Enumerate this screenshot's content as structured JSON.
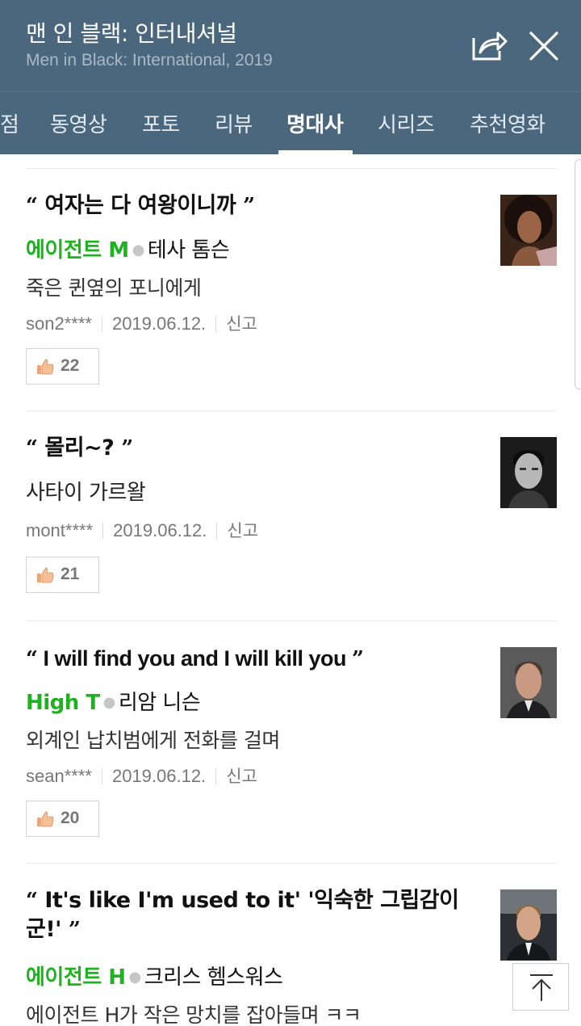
{
  "header": {
    "title": "맨 인 블랙: 인터내셔널",
    "subtitle": "Men in Black: International, 2019"
  },
  "tabs": [
    {
      "label": "점"
    },
    {
      "label": "동영상"
    },
    {
      "label": "포토"
    },
    {
      "label": "리뷰"
    },
    {
      "label": "명대사",
      "active": true
    },
    {
      "label": "시리즈"
    },
    {
      "label": "추천영화"
    }
  ],
  "quotes": [
    {
      "quote_open": "“",
      "text": "여자는 다 여왕이니까",
      "quote_close": "”",
      "role": "에이전트 M",
      "actor": "테사 톰슨",
      "situation": "죽은 퀸옆의 포니에게",
      "user": "son2****",
      "date": "2019.06.12.",
      "report": "신고",
      "likes": "22"
    },
    {
      "quote_open": "“",
      "text": "몰리~?",
      "quote_close": "”",
      "role": "",
      "actor": "",
      "situation": "사타이 가르왈",
      "user": "mont****",
      "date": "2019.06.12.",
      "report": "신고",
      "likes": "21"
    },
    {
      "quote_open": "“",
      "text": "I will find you and I will kill you",
      "quote_close": "”",
      "role": "High T",
      "actor": "리암 니슨",
      "situation": "외계인 납치범에게 전화를 걸며",
      "user": "sean****",
      "date": "2019.06.12.",
      "report": "신고",
      "likes": "20"
    },
    {
      "quote_open": "“",
      "text": "It's like I'm used to it' '익숙한 그립감이군!'",
      "quote_close": "”",
      "role": "에이전트 H",
      "actor": "크리스 헴스워스",
      "situation": "에이전트 H가 작은 망치를 잡아들며 ㅋㅋ",
      "user": "",
      "date": "",
      "report": "",
      "likes": ""
    }
  ],
  "icons": {
    "share": "share-icon",
    "close": "close-icon",
    "like": "thumbs-up-icon",
    "top": "scroll-to-top-icon"
  },
  "colors": {
    "header_bg": "#4b677d",
    "role_green": "#1eb31e"
  }
}
